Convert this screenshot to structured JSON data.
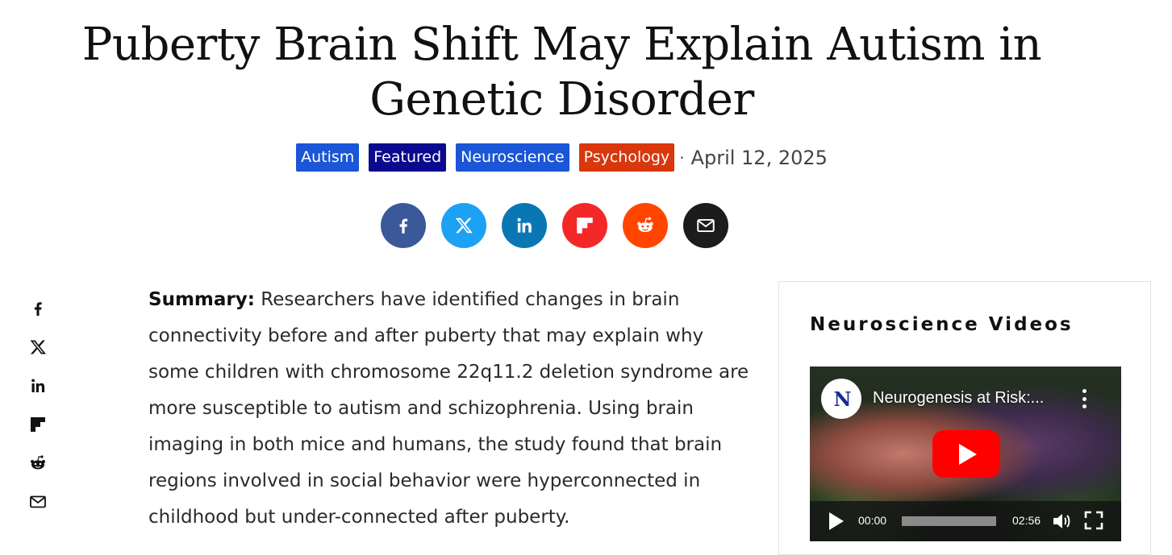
{
  "article": {
    "title": "Puberty Brain Shift May Explain Autism in Genetic Disorder",
    "tags": [
      "Autism",
      "Featured",
      "Neuroscience",
      "Psychology"
    ],
    "separator": "·",
    "date": "April 12, 2025",
    "summary_label": "Summary:",
    "summary_text": " Researchers have identified changes in brain connectivity before and after puberty that may explain why some children with chromosome 22q11.2 deletion syndrome are more susceptible to autism and schizophrenia. Using brain imaging in both mice and humans, the study found that brain regions involved in social behavior were hyperconnected in childhood but under-connected after puberty."
  },
  "share_buttons": [
    {
      "icon": "facebook-icon",
      "color": "#3b5998"
    },
    {
      "icon": "x-icon",
      "color": "#1da1f2"
    },
    {
      "icon": "linkedin-icon",
      "color": "#0a77b5"
    },
    {
      "icon": "flipboard-icon",
      "color": "#f52828"
    },
    {
      "icon": "reddit-icon",
      "color": "#ff4500"
    },
    {
      "icon": "email-icon",
      "color": "#1c1c1c"
    }
  ],
  "tag_colors": {
    "Autism": "#1a56d6",
    "Featured": "#0a0a8f",
    "Neuroscience": "#1a56d6",
    "Psychology": "#d9370c"
  },
  "sidebar": {
    "widget_title": "Neuroscience Videos",
    "video": {
      "channel_logo_text": "N",
      "title": "Neurogenesis at Risk:...",
      "current_time": "00:00",
      "duration": "02:56",
      "progress": 0
    }
  }
}
